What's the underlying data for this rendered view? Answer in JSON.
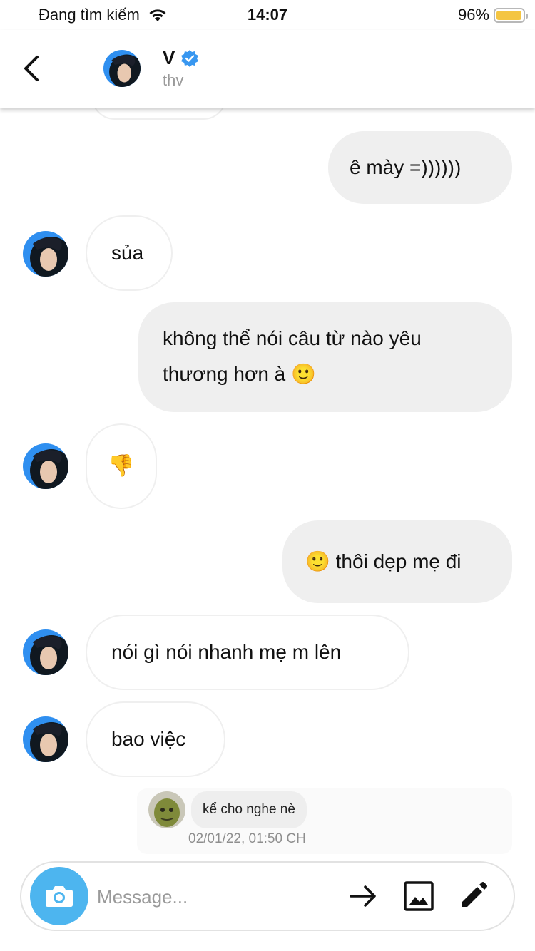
{
  "status_bar": {
    "carrier": "Đang tìm kiếm",
    "time": "14:07",
    "battery": "96%",
    "battery_level": 0.96
  },
  "header": {
    "name": "V",
    "username": "thv",
    "verified": true,
    "icons": [
      "back-icon",
      "verified-icon"
    ]
  },
  "messages": [
    {
      "sender": "me",
      "text": "ê mày =))))))"
    },
    {
      "sender": "them",
      "text": "sủa"
    },
    {
      "sender": "me",
      "line1": "không thể nói câu từ nào yêu",
      "line2": "thương hơn à 🙂"
    },
    {
      "sender": "them",
      "text": "👎"
    },
    {
      "sender": "me",
      "text": "🙂 thôi dẹp mẹ đi"
    },
    {
      "sender": "them",
      "text": "nói gì nói nhanh mẹ m lên"
    },
    {
      "sender": "them",
      "text": "bao việc"
    }
  ],
  "reply_preview": {
    "text": "kể cho nghe nè",
    "timestamp": "02/01/22, 01:50 CH"
  },
  "composer": {
    "placeholder": "Message...",
    "icons": [
      "camera-icon",
      "send-arrow-icon",
      "gallery-icon",
      "pencil-icon"
    ]
  },
  "colors": {
    "my_bubble": "#efefef",
    "camera_button": "#4db5ef",
    "verified_badge": "#3897f0",
    "battery_fill": "#f4c542"
  }
}
